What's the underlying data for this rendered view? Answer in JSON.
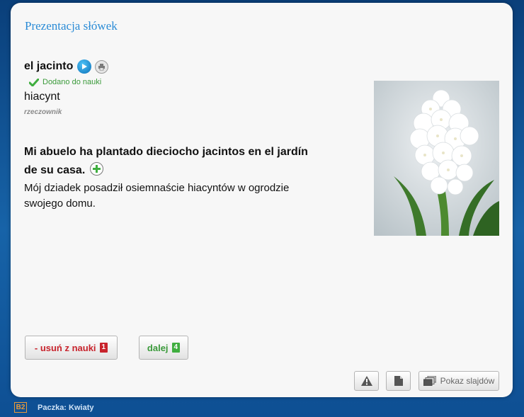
{
  "header": {
    "title": "Prezentacja słówek"
  },
  "entry": {
    "word": "el jacinto",
    "added_label": "Dodano do nauki",
    "translation": "hiacynt",
    "part_of_speech": "rzeczownik"
  },
  "example": {
    "sentence": "Mi abuelo ha plantado dieciocho jacintos en el jardín de su casa.",
    "translation": "Mój dziadek posadził osiemnaście hiacyntów w ogrodzie swojego domu."
  },
  "image": {
    "alt": "hiacynt"
  },
  "actions": {
    "remove_label": "- usuń z nauki",
    "remove_key": "1",
    "next_label": "dalej",
    "next_key": "4",
    "slideshow_label": "Pokaz slajdów"
  },
  "footer": {
    "level": "B2",
    "pack": "Paczka: Kwiaty"
  },
  "icons": {
    "play": "play-icon",
    "print": "print-icon",
    "check": "check-icon",
    "plus": "plus-icon",
    "warning": "warning-icon",
    "document": "document-icon",
    "slides": "slides-icon"
  },
  "colors": {
    "title": "#2a8bd6",
    "remove": "#c8232c",
    "next": "#3a9a3a",
    "level": "#e89a3a"
  }
}
